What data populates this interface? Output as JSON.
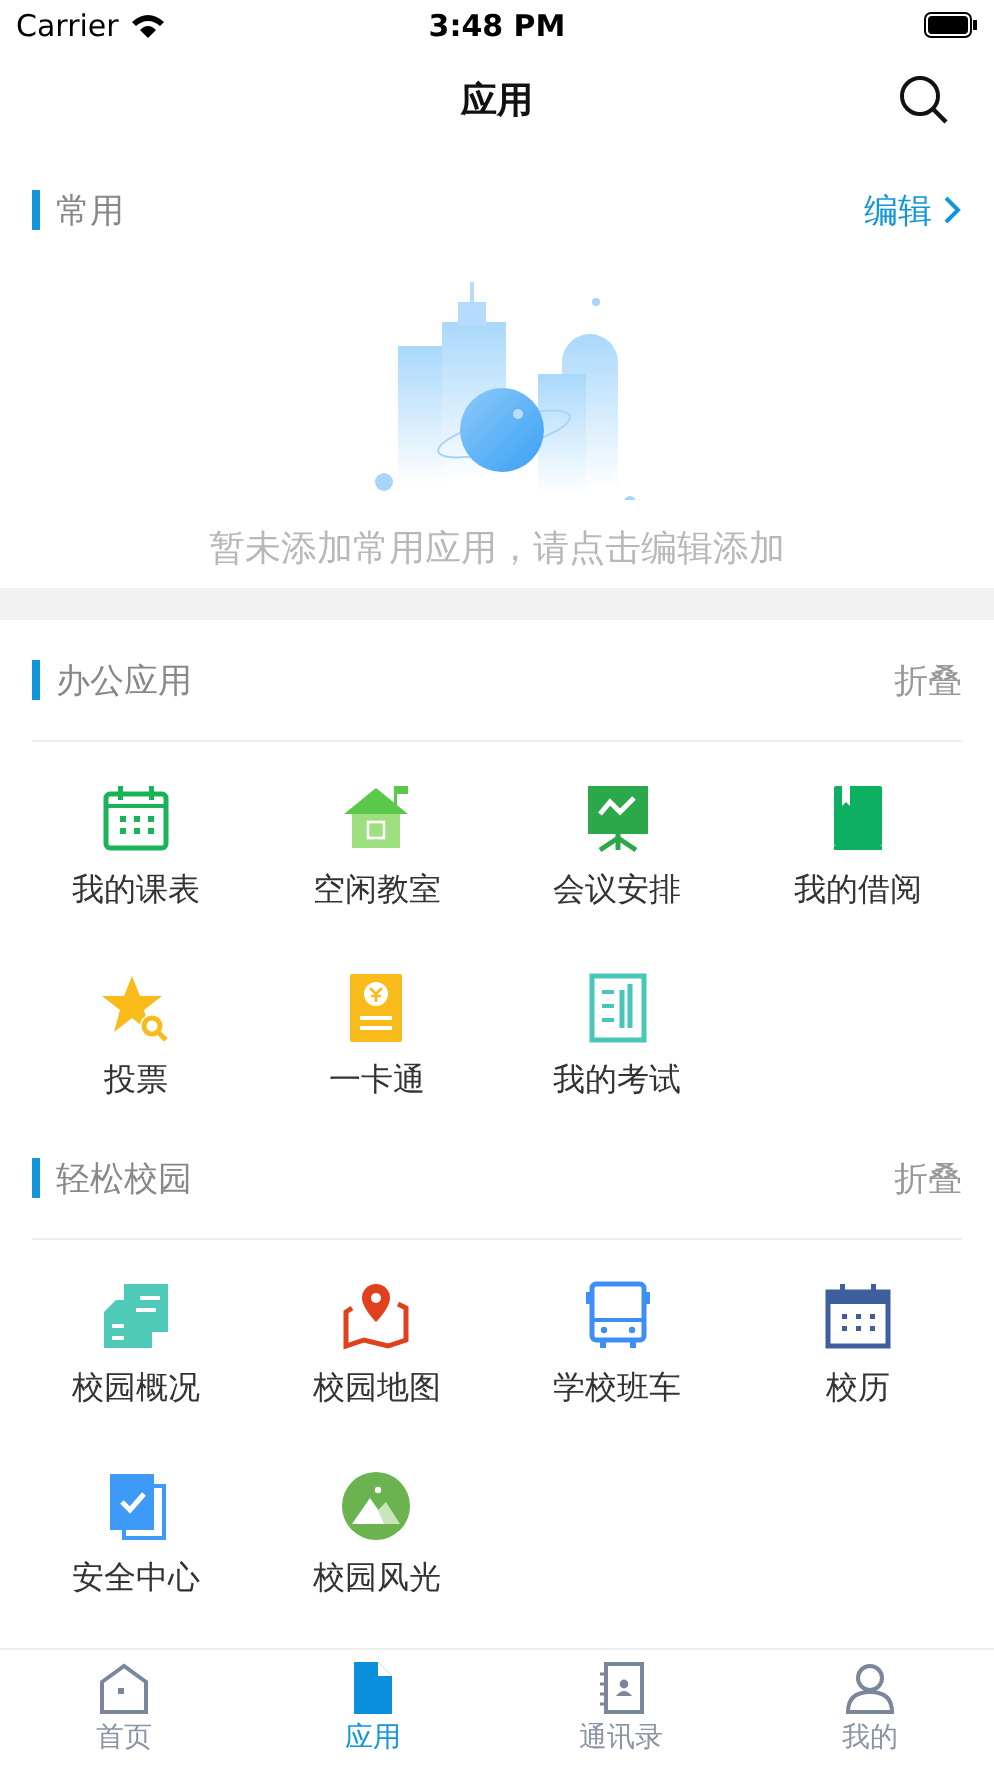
{
  "status_bar": {
    "carrier": "Carrier",
    "time": "3:48 PM"
  },
  "nav": {
    "title": "应用"
  },
  "favorites": {
    "title": "常用",
    "action": "编辑",
    "empty_text": "暂未添加常用应用，请点击编辑添加"
  },
  "sections": [
    {
      "title": "办公应用",
      "action": "折叠",
      "apps": [
        {
          "label": "我的课表",
          "kind": "schedule"
        },
        {
          "label": "空闲教室",
          "kind": "classroom"
        },
        {
          "label": "会议安排",
          "kind": "meeting"
        },
        {
          "label": "我的借阅",
          "kind": "book"
        },
        {
          "label": "投票",
          "kind": "vote"
        },
        {
          "label": "一卡通",
          "kind": "card"
        },
        {
          "label": "我的考试",
          "kind": "exam"
        }
      ]
    },
    {
      "title": "轻松校园",
      "action": "折叠",
      "apps": [
        {
          "label": "校园概况",
          "kind": "building"
        },
        {
          "label": "校园地图",
          "kind": "map"
        },
        {
          "label": "学校班车",
          "kind": "bus"
        },
        {
          "label": "校历",
          "kind": "calendar"
        },
        {
          "label": "安全中心",
          "kind": "safety"
        },
        {
          "label": "校园风光",
          "kind": "scenery"
        }
      ]
    }
  ],
  "tabs": [
    {
      "label": "首页",
      "kind": "home",
      "selected": false
    },
    {
      "label": "应用",
      "kind": "apps",
      "selected": true
    },
    {
      "label": "通讯录",
      "kind": "contacts",
      "selected": false
    },
    {
      "label": "我的",
      "kind": "me",
      "selected": false
    }
  ]
}
